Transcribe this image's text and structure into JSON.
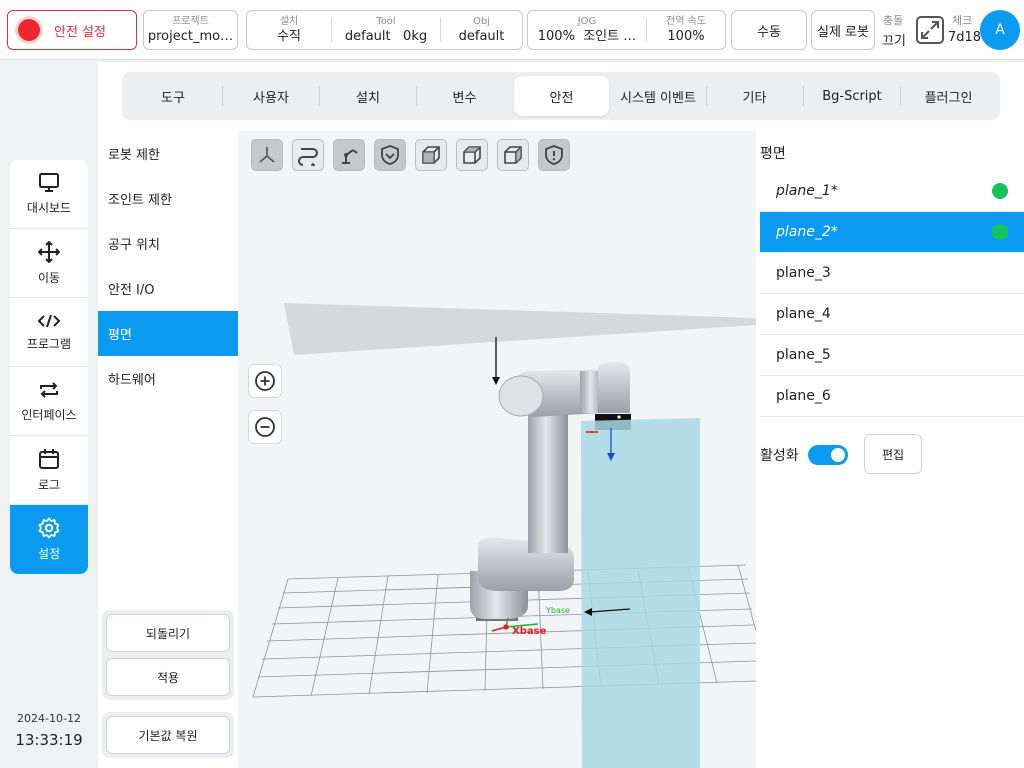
{
  "topbar": {
    "safety_label": "안전 설정",
    "project": {
      "label": "프로젝트",
      "value": "project_mo…"
    },
    "install": {
      "label": "설치",
      "value": "수직"
    },
    "tool": {
      "label": "Tool",
      "value": "default",
      "weight": "0kg"
    },
    "obj": {
      "label": "Obj",
      "value": "default"
    },
    "jog": {
      "label": "JOG",
      "percent": "100%",
      "mode": "조인트 …"
    },
    "global_speed": {
      "label": "전역 속도",
      "value": "100%"
    },
    "manual_label": "수동",
    "real_robot_label": "실제 로봇",
    "collision": {
      "label": "충돌",
      "value": "끄기"
    },
    "check": {
      "label": "체크",
      "value": "7d18"
    },
    "avatar_text": "A"
  },
  "leftnav": {
    "items": [
      {
        "label": "대시보드",
        "icon": "monitor-icon"
      },
      {
        "label": "이동",
        "icon": "move-icon"
      },
      {
        "label": "프로그램",
        "icon": "code-icon"
      },
      {
        "label": "인터페이스",
        "icon": "interface-icon"
      },
      {
        "label": "로그",
        "icon": "calendar-icon"
      },
      {
        "label": "설정",
        "icon": "gear-icon"
      }
    ],
    "date": "2024-10-12",
    "time": "13:33:19"
  },
  "tabs": [
    {
      "label": "도구"
    },
    {
      "label": "사용자"
    },
    {
      "label": "설치"
    },
    {
      "label": "변수"
    },
    {
      "label": "안전"
    },
    {
      "label": "시스템 이벤트"
    },
    {
      "label": "기타"
    },
    {
      "label": "Bg-Script"
    },
    {
      "label": "플러그인"
    }
  ],
  "active_tab": "안전",
  "subnav": {
    "items": [
      {
        "label": "로봇 제한"
      },
      {
        "label": "조인트 제한"
      },
      {
        "label": "공구 위치"
      },
      {
        "label": "안전 I/O"
      },
      {
        "label": "평면"
      },
      {
        "label": "하드웨어"
      }
    ],
    "revert_label": "되돌리기",
    "apply_label": "적용",
    "restore_label": "기본값 복원"
  },
  "viewport": {
    "x_axis_label": "Xbase",
    "y_axis_label": "Ybase"
  },
  "planes": {
    "title": "평면",
    "items": [
      {
        "name": "plane_1*"
      },
      {
        "name": "plane_2*"
      },
      {
        "name": "plane_3"
      },
      {
        "name": "plane_4"
      },
      {
        "name": "plane_5"
      },
      {
        "name": "plane_6"
      }
    ],
    "activate_label": "활성화",
    "edit_label": "편집"
  },
  "colors": {
    "accent": "#0a9bf0",
    "danger": "#d8323c",
    "status_ok": "#16c25a",
    "plane_fill": "#a9d8e3"
  }
}
